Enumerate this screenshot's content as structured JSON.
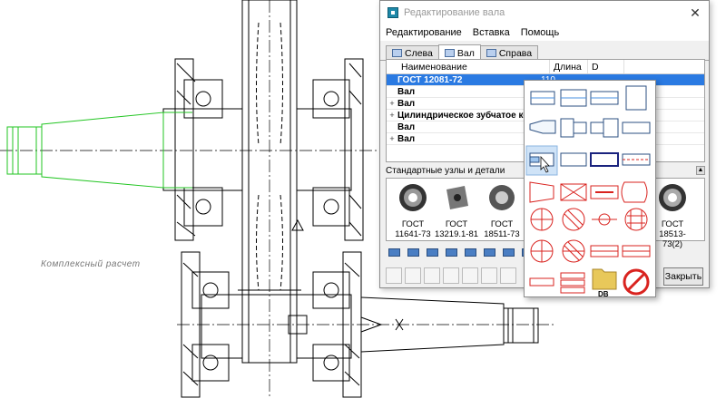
{
  "canvas": {
    "label": "Комплексный расчет"
  },
  "window": {
    "title": "Редактирование вала",
    "close_glyph": "✕",
    "menu": [
      "Редактирование",
      "Вставка",
      "Помощь"
    ],
    "tabs": [
      {
        "label": "Слева",
        "active": false
      },
      {
        "label": "Вал",
        "active": true
      },
      {
        "label": "Справа",
        "active": false
      }
    ],
    "grid": {
      "columns": [
        "Наименование",
        "Длина",
        "D"
      ],
      "rows": [
        {
          "name": "ГОСТ 12081-72",
          "length": "110",
          "expander": "",
          "selected": true
        },
        {
          "name": "Вал",
          "length": "",
          "expander": "",
          "selected": false
        },
        {
          "name": "Вал",
          "length": "",
          "expander": "+",
          "selected": false
        },
        {
          "name": "Цилиндрическое зубчатое кол",
          "length": "",
          "expander": "+",
          "selected": false
        },
        {
          "name": "Вал",
          "length": "",
          "expander": "",
          "selected": false
        },
        {
          "name": "Вал",
          "length": "",
          "expander": "+",
          "selected": false
        }
      ]
    },
    "standard_section": {
      "label": "Стандартные узлы и детали",
      "collapse_glyph": "▲"
    },
    "parts": [
      {
        "code": "ГОСТ",
        "number": "11641-73"
      },
      {
        "code": "ГОСТ",
        "number": "13219.1-81"
      },
      {
        "code": "ГОСТ",
        "number": "18511-73"
      },
      {
        "code": "ГОСТ",
        "number": "18513-73(2)"
      }
    ],
    "close_button": "Закрыть"
  },
  "popup": {
    "folder_label": "DB",
    "highlighted_index": 8
  },
  "colors": {
    "selection": "#2a7ae2",
    "green_shaft": "#22c522",
    "accent_red": "#d9231f",
    "accent_blue": "#2b4f80"
  }
}
